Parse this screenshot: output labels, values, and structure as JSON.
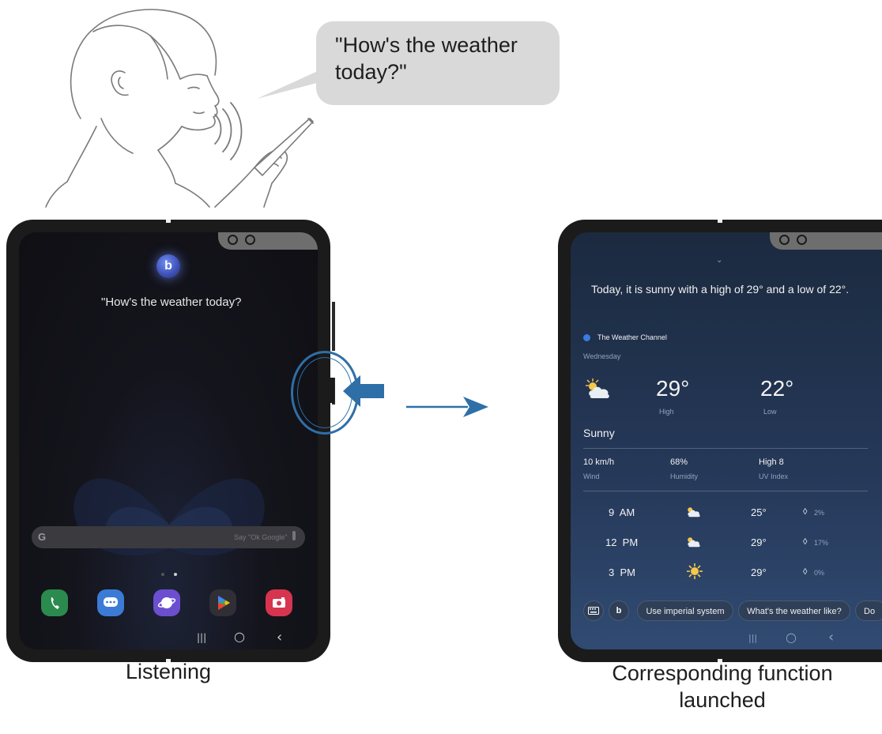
{
  "speech_bubble": {
    "text": "\"How's the weather today?\""
  },
  "left_phone": {
    "query": "\"How's the weather today?",
    "search_hint": "Say \"Ok Google\"",
    "apps": [
      "phone-icon",
      "messages-icon",
      "internet-icon",
      "play-store-icon",
      "camera-icon"
    ],
    "navbar": {
      "recents": "|||",
      "home": "○",
      "back": "‹"
    }
  },
  "right_phone": {
    "response": "Today, it is sunny with a high of 29° and a low of 22°.",
    "provider": "The Weather Channel",
    "day": "Wednesday",
    "high": {
      "value": "29°",
      "label": "High"
    },
    "low": {
      "value": "22°",
      "label": "Low"
    },
    "condition": "Sunny",
    "details": [
      {
        "value": "10 km/h",
        "label": "Wind"
      },
      {
        "value": "68%",
        "label": "Humidity"
      },
      {
        "value": "High 8",
        "label": "UV Index"
      }
    ],
    "hourly": [
      {
        "time": "9  AM",
        "icon": "partly-cloudy-icon",
        "temp": "25°",
        "precip": "2%"
      },
      {
        "time": "12  PM",
        "icon": "partly-cloudy-icon",
        "temp": "29°",
        "precip": "17%"
      },
      {
        "time": "3  PM",
        "icon": "sunny-icon",
        "temp": "29°",
        "precip": "0%"
      }
    ],
    "chips": [
      "Use imperial system",
      "What's the weather like?",
      "Do"
    ],
    "navbar": {
      "recents": "|||",
      "home": "○",
      "back": "‹"
    }
  },
  "captions": {
    "left": "Listening",
    "right": "Corresponding function launched"
  },
  "colors": {
    "accent": "#2e6fa8",
    "bubble": "#d9d9d9",
    "frame": "#1b1b1b"
  }
}
